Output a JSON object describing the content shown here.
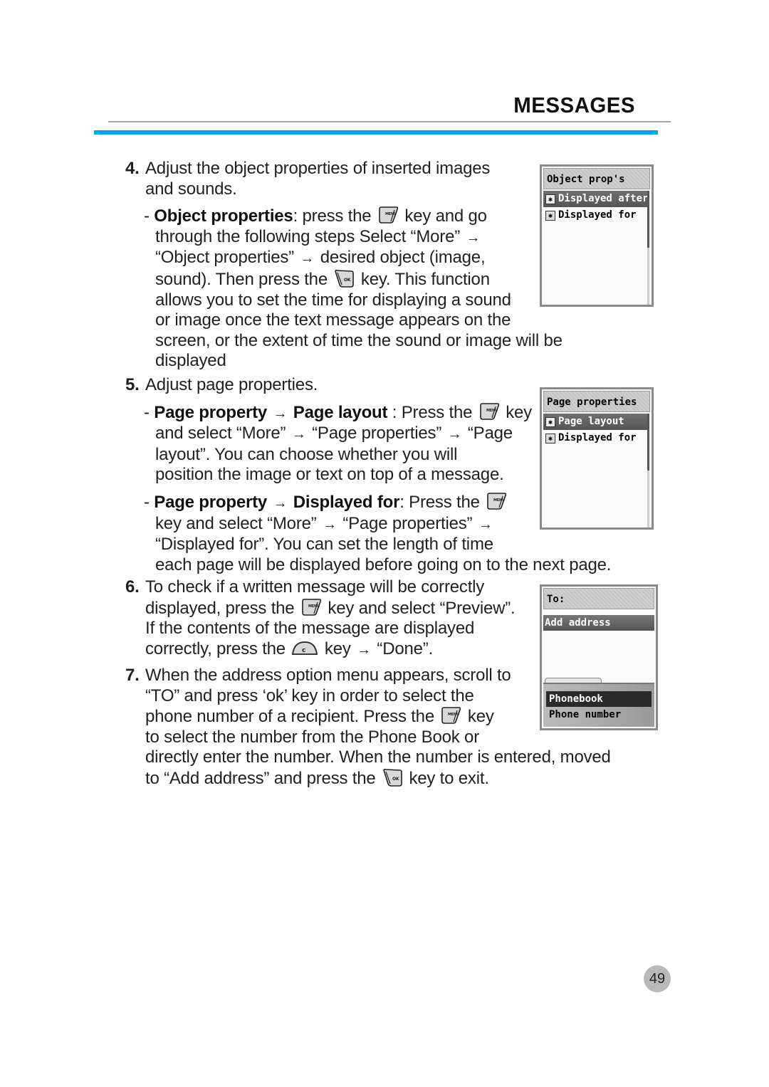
{
  "header": {
    "section_title": "MESSAGES",
    "accent_color": "#00a6e6"
  },
  "steps": {
    "s4": {
      "num": "4.",
      "l1": "Adjust the object properties of inserted images",
      "l2": "and sounds.",
      "bold1": "Object properties",
      "t1": ": press the",
      "t2": "key and go",
      "l4": "through the following steps Select “More”",
      "l5a": "“Object properties”",
      "l5b": "desired object (image,",
      "l6a": "sound). Then press the",
      "l6b": "key. This function",
      "l7": "allows you to set the time for displaying a sound",
      "l8": "or image once the text message appears on the",
      "l9": "screen, or the extent of time the sound or image will be",
      "l10": "displayed"
    },
    "s5": {
      "num": "5.",
      "l1": "Adjust page properties.",
      "b1": "Page property",
      "b2": "Page layout",
      "t1": " : Press the",
      "t2": "key",
      "l3a": "and select “More”",
      "l3b": "“Page properties”",
      "l3c": "“Page",
      "l4": "layout”. You can choose whether you will",
      "l5": "position the image or text on top of a message.",
      "b3": "Page property",
      "b4": "Displayed for",
      "t3": ": Press the",
      "l7a": "key and select “More”",
      "l7b": "“Page properties”",
      "l8": "“Displayed for”. You can set the length of time",
      "l9": "each page will be displayed before going on to the next page."
    },
    "s6": {
      "num": "6.",
      "l1": "To check if a written message will be correctly",
      "l2a": "displayed, press the",
      "l2b": "key and select “Preview”.",
      "l3": "If the contents of the message are displayed",
      "l4a": "correctly, press the",
      "l4b": "key",
      "l4c": "“Done”."
    },
    "s7": {
      "num": "7.",
      "l1": "When the address option menu appears, scroll to",
      "l2": "“TO” and press ‘ok’ key in order to select the",
      "l3a": "phone number of a recipient. Press the",
      "l3b": "key",
      "l4": "to select the number from the Phone Book or",
      "l5": "directly enter the number. When the number is entered, moved",
      "l6a": "to “Add address” and press the",
      "l6b": "key to exit."
    }
  },
  "keys": {
    "menu": "MENU",
    "ok": "OK",
    "clear": "C",
    "arrow": "→"
  },
  "screens": {
    "object_props": {
      "title": "Object prop's",
      "items": [
        "Displayed after",
        "Displayed for"
      ],
      "selected_index": 0
    },
    "page_props": {
      "title": "Page properties",
      "items": [
        "Page layout",
        "Displayed for"
      ],
      "selected_index": 0
    },
    "to_screen": {
      "title": "To:",
      "highlight": "Add address",
      "popup_items": [
        "Phonebook",
        "Phone number"
      ],
      "popup_selected_index": 0
    }
  },
  "footer": {
    "page_number": "49"
  }
}
